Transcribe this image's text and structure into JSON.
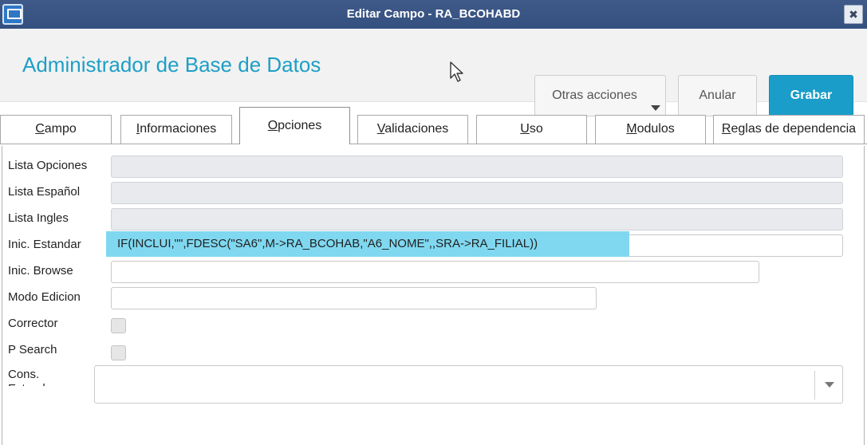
{
  "window": {
    "title": "Editar Campo - RA_BCOHABD",
    "app_icon": "monitor-icon",
    "close_icon": "close-icon",
    "close_glyph": "✖"
  },
  "header": {
    "title": "Administrador de Base de Datos",
    "more_actions": "Otras acciones",
    "cancel": "Anular",
    "save": "Grabar"
  },
  "tabs": [
    {
      "label": "Campo",
      "mnemonic": "C",
      "rest": "ampo"
    },
    {
      "label": "Informaciones",
      "mnemonic": "I",
      "rest": "nformaciones"
    },
    {
      "label": "Opciones",
      "mnemonic": "O",
      "rest": "pciones",
      "active": true
    },
    {
      "label": "Validaciones",
      "mnemonic": "V",
      "rest": "alidaciones"
    },
    {
      "label": "Uso",
      "mnemonic": "U",
      "rest": "so"
    },
    {
      "label": "Modulos",
      "mnemonic": "M",
      "rest": "odulos"
    },
    {
      "label": "Reglas de dependencia",
      "mnemonic": "R",
      "rest": "eglas de dependencia"
    }
  ],
  "form": {
    "lista_opciones": {
      "label": "Lista Opciones",
      "value": ""
    },
    "lista_espanol": {
      "label": "Lista Español",
      "value": ""
    },
    "lista_ingles": {
      "label": "Lista Ingles",
      "value": ""
    },
    "inic_estandar": {
      "label": "Inic. Estandar",
      "value": "IF(INCLUI,\"\",FDESC(\"SA6\",M->RA_BCOHAB,\"A6_NOME\",,SRA->RA_FILIAL))"
    },
    "inic_browse": {
      "label": "Inic. Browse",
      "value": ""
    },
    "modo_edicion": {
      "label": "Modo Edicion",
      "value": ""
    },
    "corrector": {
      "label": "Corrector",
      "checked": false
    },
    "p_search": {
      "label": "P Search",
      "checked": false
    },
    "cons_estandar": {
      "label": "Cons. Estandar",
      "value": ""
    }
  },
  "colors": {
    "accent": "#1a9dc8",
    "title_bar": "#3a5584",
    "selection": "#7fd8f0"
  }
}
